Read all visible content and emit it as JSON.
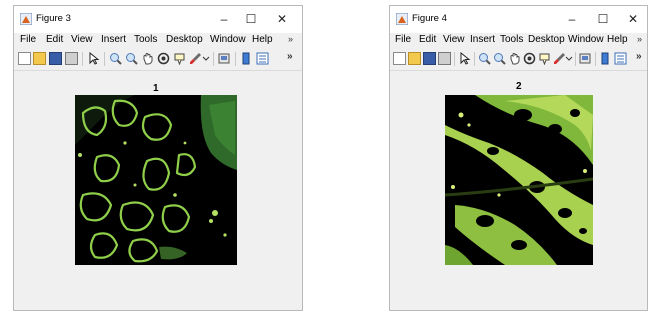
{
  "figure3": {
    "title": "Figure 3",
    "axes_title": "1",
    "menu": [
      "File",
      "Edit",
      "View",
      "Insert",
      "Tools",
      "Desktop",
      "Window",
      "Help"
    ],
    "menu_more": "»",
    "toolbar_more": "»",
    "controls": {
      "minimize": "–",
      "maximize": "☐",
      "close": "✕"
    },
    "image_description": "segmented leaf image with disease spot outlines on black background"
  },
  "figure4": {
    "title": "Figure 4",
    "axes_title": "2",
    "menu": [
      "File",
      "Edit",
      "View",
      "Insert",
      "Tools",
      "Desktop",
      "Window",
      "Help"
    ],
    "menu_more": "»",
    "toolbar_more": "»",
    "controls": {
      "minimize": "–",
      "maximize": "☐",
      "close": "✕"
    },
    "image_description": "segmented leaf image showing diseased leaf regions on black background"
  },
  "toolbar_icons": [
    "new-file-icon",
    "open-folder-icon",
    "save-icon",
    "print-icon",
    "pointer-icon",
    "zoom-in-icon",
    "zoom-out-icon",
    "pan-icon",
    "rotate-3d-icon",
    "data-cursor-icon",
    "brush-icon",
    "link-plot-icon",
    "colorbar-icon",
    "legend-icon"
  ],
  "colors": {
    "accent_green": "#8fcf4a",
    "dark_leaf": "#2f6a2a",
    "background": "#f0f0f0"
  }
}
